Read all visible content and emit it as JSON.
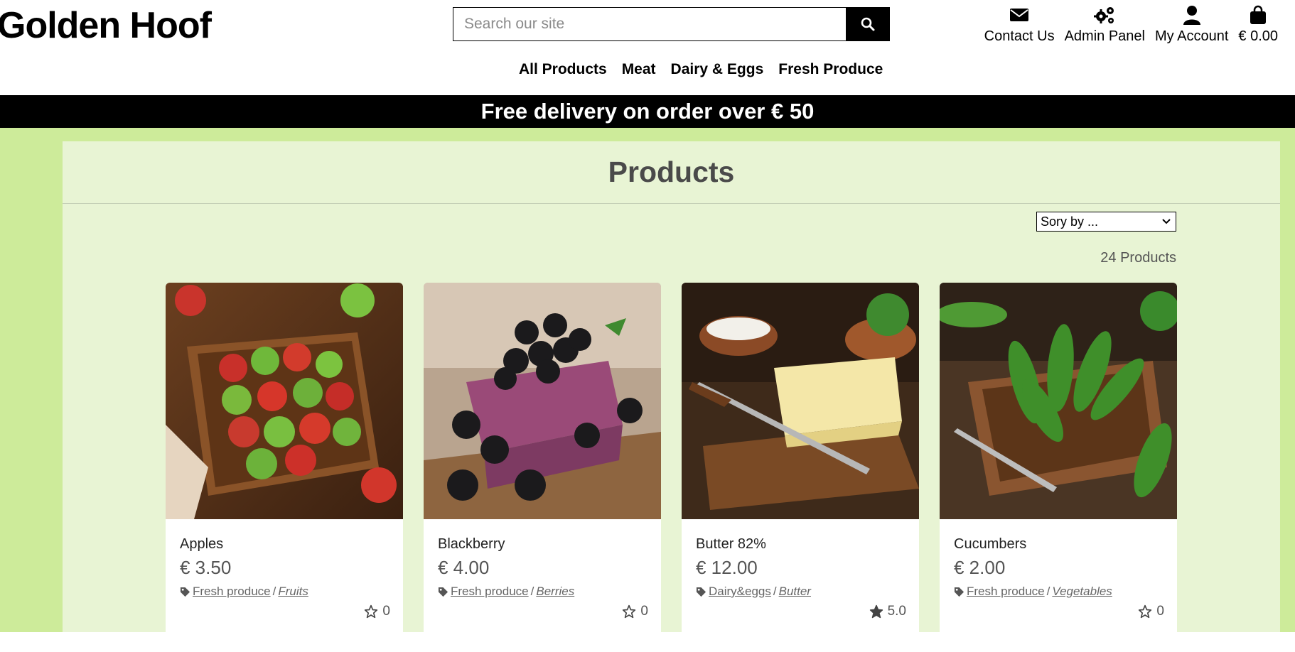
{
  "header": {
    "brand": "Golden Hoof",
    "search_placeholder": "Search our site",
    "utilities": [
      {
        "label": "Contact Us",
        "icon": "envelope-icon"
      },
      {
        "label": "Admin Panel",
        "icon": "gears-icon"
      },
      {
        "label": "My Account",
        "icon": "user-icon"
      },
      {
        "label": "€ 0.00",
        "icon": "shopping-bag-icon"
      }
    ],
    "nav": [
      "All Products",
      "Meat",
      "Dairy & Eggs",
      "Fresh Produce"
    ]
  },
  "banner": "Free delivery on order over € 50",
  "main": {
    "title": "Products",
    "sort_label": "Sory by ...",
    "product_count": "24 Products",
    "products": [
      {
        "name": "Apples",
        "price": "€ 3.50",
        "category": "Fresh produce",
        "subcategory": "Fruits",
        "rating": "0",
        "rated": false
      },
      {
        "name": "Blackberry",
        "price": "€ 4.00",
        "category": "Fresh produce",
        "subcategory": "Berries",
        "rating": "0",
        "rated": false
      },
      {
        "name": "Butter 82%",
        "price": "€ 12.00",
        "category": "Dairy&eggs",
        "subcategory": "Butter",
        "rating": "5.0",
        "rated": true
      },
      {
        "name": "Cucumbers",
        "price": "€ 2.00",
        "category": "Fresh produce",
        "subcategory": "Vegetables",
        "rating": "0",
        "rated": false
      }
    ]
  },
  "colors": {
    "page_bg_green": "#cdeb9a",
    "panel_bg": "#e8f4d4",
    "banner_bg": "#000000",
    "banner_text": "#ffffff"
  }
}
